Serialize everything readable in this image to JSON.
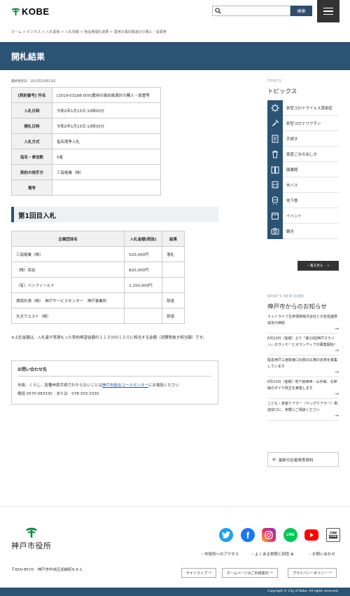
{
  "header": {
    "logo_text": "KOBE",
    "search_placeholder": "",
    "search_button": "検索"
  },
  "breadcrumb": "ホーム > ビジネス > 入札関係 > 入札情報 > 物品等開札結果 > 農用の風向風速計の購入・設置等",
  "page_title": "開札結果",
  "last_updated": "最終更新日：2022年03月23日",
  "contract_table": [
    {
      "label": "[契約番号] 件名",
      "value": "[2019-03298-000]農用の風向風速計の購入・設置等"
    },
    {
      "label": "入札日時",
      "value": "令和2年1月15日 10時00分"
    },
    {
      "label": "開札日時",
      "value": "令和2年1月15日 10時30分"
    },
    {
      "label": "入札方式",
      "value": "指名競争入札"
    },
    {
      "label": "指名・参加数",
      "value": "5者"
    },
    {
      "label": "契約の相手方",
      "value": "三協電業（株）"
    },
    {
      "label": "備考",
      "value": ""
    }
  ],
  "section_heading": "第1回目入札",
  "bid_table": {
    "headers": [
      "企業団体名",
      "入札金額(税抜)",
      "結果"
    ],
    "rows": [
      {
        "company": "三協電業（株）",
        "amount": "520,000円",
        "result": "落札"
      },
      {
        "company": "（株）佰谷",
        "amount": "820,000円",
        "result": ""
      },
      {
        "company": "（有）ペンフィールド",
        "amount": "1,150,000円",
        "result": ""
      },
      {
        "company": "環境計測（株）　神戸サービスセンター　神戸事業所",
        "amount": "",
        "result": "辞退"
      },
      {
        "company": "丸文ウエスト（株）",
        "amount": "",
        "result": "辞退"
      }
    ]
  },
  "note": "※上記金額は、入札者が見積もった契約希望金額の１１０分の１００に相当する金額（消費税抜き相当額）です。",
  "contact": {
    "title": "お問い合わせ先",
    "line1_prefix": "市政、くらし、各種申請手続でわからないことは",
    "line1_link": "神戸市総合コールセンター",
    "line1_suffix": "にお電話ください",
    "line2": "電話 0570-083330　または　078-333-3330"
  },
  "topics": {
    "sub": "TOPICS",
    "title": "トピックス",
    "items": [
      {
        "label": "新型コロナウイルス感染症",
        "icon": "virus-icon"
      },
      {
        "label": "新型コロナワクチン",
        "icon": "syringe-icon"
      },
      {
        "label": "手続き",
        "icon": "document-icon"
      },
      {
        "label": "家庭ごみの出し方",
        "icon": "trash-icon"
      },
      {
        "label": "図書館",
        "icon": "book-icon"
      },
      {
        "label": "市バス",
        "icon": "bus-icon"
      },
      {
        "label": "地下鉄",
        "icon": "train-icon"
      },
      {
        "label": "イベント",
        "icon": "calendar-icon"
      },
      {
        "label": "観光",
        "icon": "camera-icon"
      }
    ],
    "more": "一覧を見る"
  },
  "news": {
    "sub": "WHAT'S NEW KOBE",
    "title": "神戸市からのお知らせ",
    "items": [
      "メットライフ生命保険株式会社との包括連携協定の締結",
      "6月10日（金曜）より「第10回神戸マラソン」のランナーとボランティアの募集開始！",
      "阪急神戸三宮駅東口北側の広場の名称を募集しています",
      "6月10日（金曜）地下鉄西神・山手線、北神線のダイヤ改正を実施します",
      "こども・若者ケアラー（ヤングケアラー）相談窓口に、気軽にご相談ください"
    ]
  },
  "press_button": "最新の記者発表資料",
  "footer": {
    "city_name": "神戸市役所",
    "address": "〒650-8570　神戸市中央区加納町6-5-1",
    "links": [
      "市役所へのアクセス",
      "よくある質問と回答",
      "お問い合わせ"
    ],
    "buttons": [
      "サイトマップ",
      "ホームページのご利用案内",
      "プライバシーポリシー"
    ],
    "copyright": "Copyright © City of Kobe. All rights reserved.",
    "social": [
      {
        "name": "twitter",
        "color": "#1da1f2"
      },
      {
        "name": "facebook",
        "color": "#1877f2"
      },
      {
        "name": "instagram",
        "color": "#d6249f"
      },
      {
        "name": "line",
        "color": "#06c755",
        "text": "LINE"
      },
      {
        "name": "youtube",
        "color": "#ff0000"
      }
    ],
    "kobe_paper": {
      "line1": "広報紙",
      "line2": "KOBE"
    }
  },
  "colors": {
    "primary": "#2b5373",
    "banner": "#2b5373"
  }
}
